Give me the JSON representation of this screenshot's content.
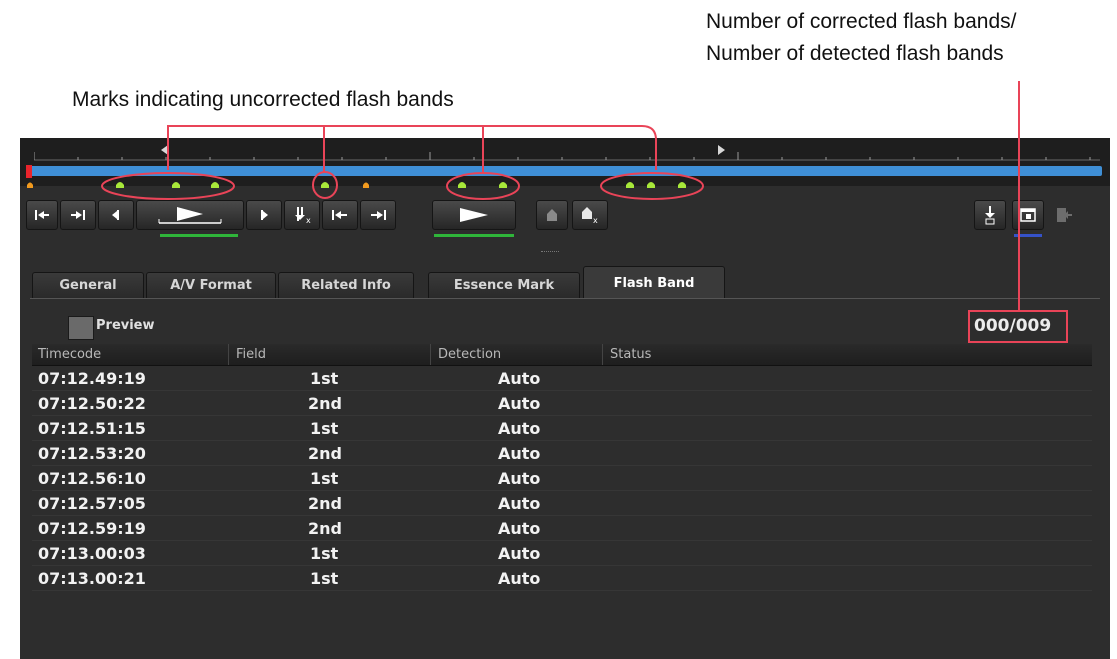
{
  "annotations": {
    "counter_line1": "Number of corrected flash bands/",
    "counter_line2": "Number of detected flash bands",
    "marks_label": "Marks indicating uncorrected flash bands"
  },
  "colors": {
    "seekbar": "#3f8fd6",
    "uncorrected_mark": "#a8e83a",
    "orange_mark": "#f29a1e",
    "callout": "#e94458",
    "active_green": "#2fb53a"
  },
  "transport": {
    "buttons": [
      "go-to-start-icon",
      "go-to-end-icon",
      "step-back-icon",
      "shuttle-play-icon",
      "step-forward-icon",
      "delete-mark-icon",
      "previous-mark-icon",
      "next-mark-icon",
      "play-icon",
      "add-mark-icon",
      "delete-essence-mark-icon",
      "download-icon",
      "monitor-icon",
      "export-icon"
    ]
  },
  "tabs": [
    {
      "label": "General"
    },
    {
      "label": "A/V Format"
    },
    {
      "label": "Related Info"
    },
    {
      "label": "Essence Mark"
    },
    {
      "label": "Flash Band",
      "active": true
    }
  ],
  "flash_band": {
    "preview_label": "Preview",
    "counter": "000/009",
    "columns": [
      "Timecode",
      "Field",
      "Detection",
      "Status"
    ],
    "rows": [
      {
        "timecode": "07:12.49:19",
        "field": "1st",
        "detection": "Auto",
        "status": ""
      },
      {
        "timecode": "07:12.50:22",
        "field": "2nd",
        "detection": "Auto",
        "status": ""
      },
      {
        "timecode": "07:12.51:15",
        "field": "1st",
        "detection": "Auto",
        "status": ""
      },
      {
        "timecode": "07:12.53:20",
        "field": "2nd",
        "detection": "Auto",
        "status": ""
      },
      {
        "timecode": "07:12.56:10",
        "field": "1st",
        "detection": "Auto",
        "status": ""
      },
      {
        "timecode": "07:12.57:05",
        "field": "2nd",
        "detection": "Auto",
        "status": ""
      },
      {
        "timecode": "07:12.59:19",
        "field": "2nd",
        "detection": "Auto",
        "status": ""
      },
      {
        "timecode": "07:13.00:03",
        "field": "1st",
        "detection": "Auto",
        "status": ""
      },
      {
        "timecode": "07:13.00:21",
        "field": "1st",
        "detection": "Auto",
        "status": ""
      }
    ]
  }
}
